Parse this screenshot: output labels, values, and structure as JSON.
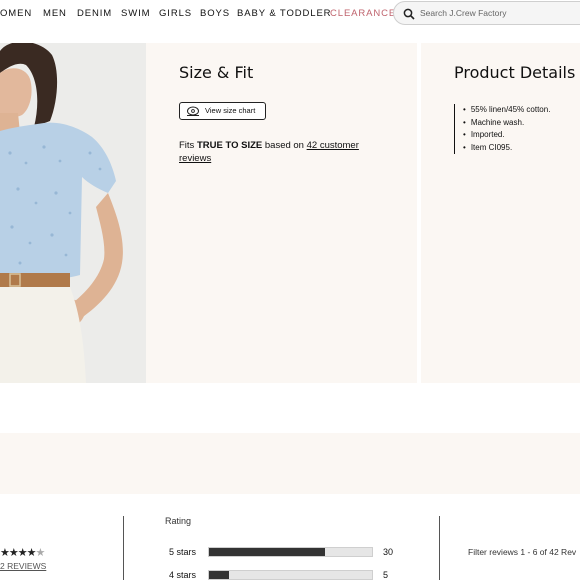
{
  "nav": {
    "items": [
      "OMEN",
      "MEN",
      "DENIM",
      "SWIM",
      "GIRLS",
      "BOYS",
      "BABY & TODDLER",
      "CLEARANCE"
    ],
    "clearance_color": "#c0646e",
    "search_placeholder": "Search J.Crew Factory"
  },
  "size_fit": {
    "title": "Size & Fit",
    "size_chart_button": "View size chart",
    "fits_prefix": "Fits ",
    "fits_emphasis": "TRUE TO SIZE",
    "fits_middle": " based on ",
    "fits_link_line1": "42 customer",
    "fits_link_line2": "reviews"
  },
  "product_details": {
    "title": "Product Details",
    "items": [
      "55% linen/45% cotton.",
      "Machine wash.",
      "Imported.",
      "Item CI095."
    ]
  },
  "reviews": {
    "stars_shown": "★★★★",
    "star_partial": "★",
    "reviews_link": "2 REVIEWS",
    "rating_label": "Rating",
    "rows": [
      {
        "label": "5 stars",
        "count": "30",
        "fraction": 0.71
      },
      {
        "label": "4 stars",
        "count": "5",
        "fraction": 0.12
      }
    ],
    "filter_text": "Filter reviews 1 - 6 of 42 Rev"
  },
  "colors": {
    "panel_bg": "#fbf7f3",
    "bar_fill": "#333333"
  }
}
